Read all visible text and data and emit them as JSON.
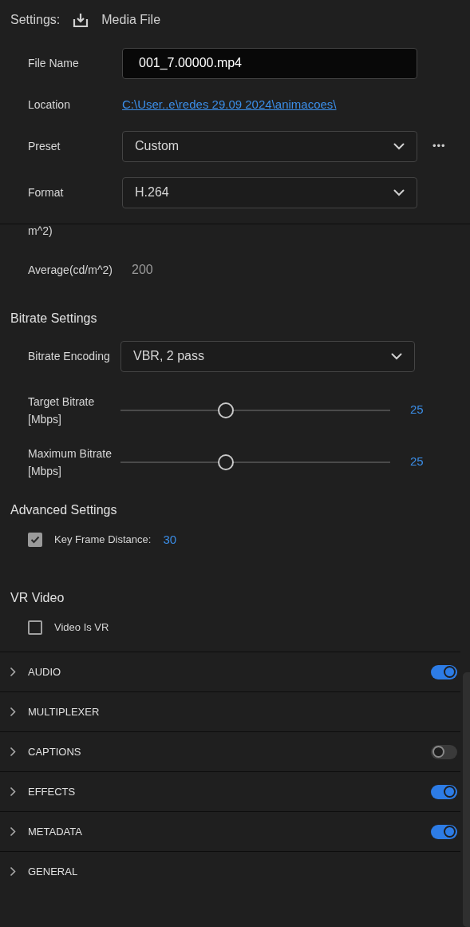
{
  "header": {
    "title": "Settings:",
    "target": "Media File"
  },
  "fields": [
    {
      "kind": "input",
      "label": "File Name",
      "value": "001_7.00000.mp4"
    },
    {
      "kind": "link",
      "label": "Location",
      "value": "C:\\User..e\\redes 29.09 2024\\animacoes\\"
    },
    {
      "kind": "select",
      "label": "Preset",
      "value": "Custom",
      "more": "•••"
    },
    {
      "kind": "select",
      "label": "Format",
      "value": "H.264"
    }
  ],
  "partial_label": "m^2)",
  "average": {
    "label": "Average(cd/m^2)",
    "value": "200"
  },
  "bitrate": {
    "title": "Bitrate Settings",
    "encoding": {
      "label": "Bitrate Encoding",
      "value": "VBR, 2 pass"
    },
    "sliders": [
      {
        "label": "Target Bitrate [Mbps]",
        "level": 0.39,
        "reading": "25"
      },
      {
        "label": "Maximum Bitrate [Mbps]",
        "level": 0.39,
        "reading": "25"
      }
    ]
  },
  "advanced": {
    "title": "Advanced Settings",
    "checkbox": {
      "label": "Key Frame Distance:",
      "checked": true,
      "value": "30"
    }
  },
  "vr": {
    "title": "VR Video",
    "checkbox": {
      "label": "Video Is VR",
      "checked": false
    }
  },
  "sections": [
    {
      "label": "AUDIO",
      "kind": "toggle",
      "on": true
    },
    {
      "label": "MULTIPLEXER",
      "kind": "plain"
    },
    {
      "label": "CAPTIONS",
      "kind": "toggle",
      "on": false
    },
    {
      "label": "EFFECTS",
      "kind": "toggle",
      "on": true
    },
    {
      "label": "METADATA",
      "kind": "toggle",
      "on": true
    },
    {
      "label": "GENERAL",
      "kind": "plain"
    }
  ]
}
